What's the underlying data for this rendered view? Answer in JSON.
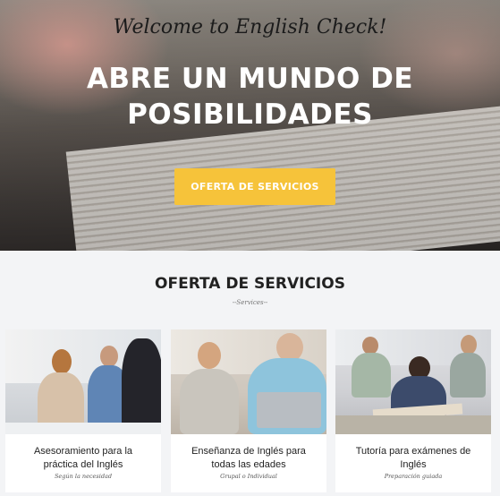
{
  "hero": {
    "welcome": "Welcome to English Check!",
    "headline_line1": "ABRE UN MUNDO DE",
    "headline_line2": "POSIBILIDADES",
    "cta_label": "OFERTA DE SERVICIOS"
  },
  "services": {
    "title": "OFERTA DE SERVICIOS",
    "subtitle": "--Services--",
    "cards": [
      {
        "title_line1": "Asesoramiento para la",
        "title_line2": "práctica del Inglés",
        "subtitle": "Según la necesidad"
      },
      {
        "title_line1": "Enseñanza de Inglés para",
        "title_line2": "todas las edades",
        "subtitle": "Grupal o Individual"
      },
      {
        "title_line1": "Tutoría para exámenes de",
        "title_line2": "Inglés",
        "subtitle": "Preparación guiada"
      }
    ]
  },
  "colors": {
    "accent": "#f6c33a",
    "heading": "#222222",
    "background": "#f3f4f6"
  }
}
